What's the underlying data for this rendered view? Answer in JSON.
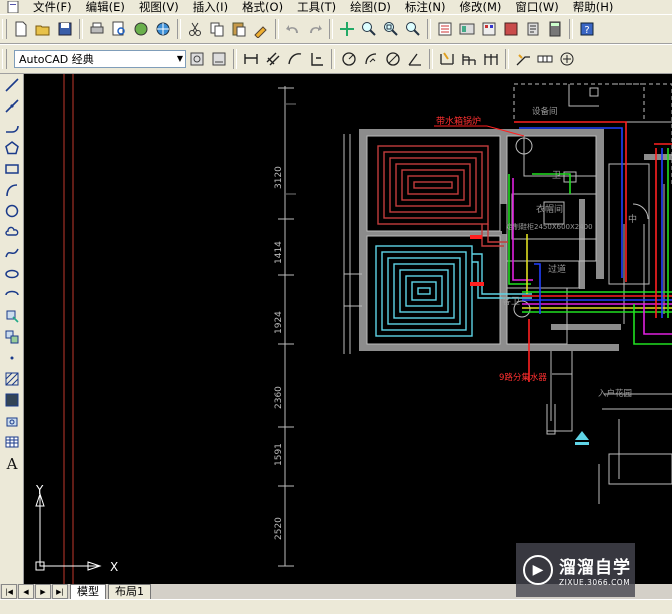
{
  "menu": [
    "文件(F)",
    "编辑(E)",
    "视图(V)",
    "插入(I)",
    "格式(O)",
    "工具(T)",
    "绘图(D)",
    "标注(N)",
    "修改(M)",
    "窗口(W)",
    "帮助(H)"
  ],
  "workspace": {
    "selected": "AutoCAD 经典"
  },
  "drawing": {
    "dimensions": [
      "3120",
      "1414",
      "1924",
      "2360",
      "1591",
      "2520"
    ],
    "room_labels": {
      "equipment_room": "设备间",
      "wall_boiler": "带水箱锅炉",
      "wardrobe": "衣帽间",
      "corridor": "过道",
      "guest_bath": "客卫",
      "bath": "卫",
      "middle": "中",
      "manifold": "9路分集水器",
      "entry_garden": "入户花园",
      "shoe_cabinet": "定制鞋柜2450X600X2400"
    },
    "colors": {
      "background": "#000000",
      "wall": "#8c8c8c",
      "line_gray": "#bcbcbc",
      "heat_red": "#c23c3c",
      "heat_cyan": "#5fd4e6",
      "pipe_red": "#ff2020",
      "pipe_blue": "#2040ff",
      "pipe_green": "#20e020",
      "pipe_magenta": "#e020e0",
      "pipe_yellow": "#e0e020"
    }
  },
  "ucs": {
    "x_label": "X",
    "y_label": "Y"
  },
  "tabs": {
    "model": "模型",
    "layout1": "布局1"
  },
  "watermark": {
    "title": "溜溜自学",
    "url": "ZIXUE.3066.COM"
  }
}
